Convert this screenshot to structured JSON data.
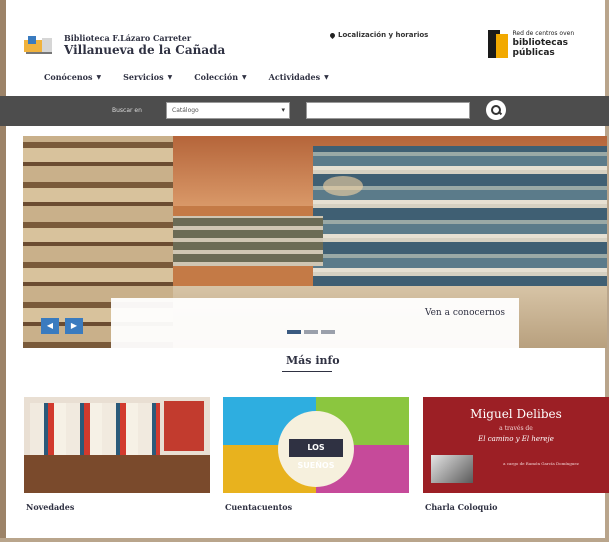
{
  "header": {
    "library_top": "Biblioteca F.Lázaro Carreter",
    "library_name": "Villanueva de la Cañada",
    "location_link": "Localización y horarios",
    "network_small": "Red de centros  oven",
    "network_big": "bibliotecas públicas"
  },
  "nav": {
    "items": [
      {
        "label": "Conócenos"
      },
      {
        "label": "Servicios"
      },
      {
        "label": "Colección"
      },
      {
        "label": "Actividades"
      }
    ]
  },
  "search": {
    "label": "Buscar en",
    "select_value": "Catálogo",
    "input_value": ""
  },
  "hero": {
    "caption": "Ven a conocernos"
  },
  "more_info": "Más info",
  "cards": [
    {
      "label": "Novedades"
    },
    {
      "label": "Cuentacuentos",
      "image_title": "LOS SUEÑOS"
    },
    {
      "label": "Charla Coloquio",
      "name": "Miguel Delibes",
      "subtitle": "a través de",
      "book": "El camino y El hereje",
      "small": "a cargo de Ramón García Domínguez"
    }
  ],
  "colors": {
    "search_bar": "#4d4d4d",
    "slider_button": "#3a7bbf",
    "text_dark": "#2f3142",
    "card3_bg": "#9c1f25"
  }
}
